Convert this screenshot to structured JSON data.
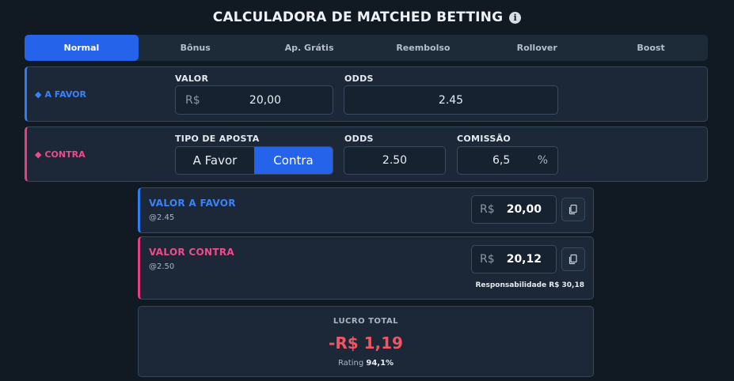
{
  "header": {
    "title": "CALCULADORA DE MATCHED BETTING",
    "info_icon": "info-icon"
  },
  "tabs": [
    {
      "label": "Normal",
      "active": true
    },
    {
      "label": "Bônus"
    },
    {
      "label": "Ap. Grátis"
    },
    {
      "label": "Reembolso"
    },
    {
      "label": "Rollover"
    },
    {
      "label": "Boost"
    }
  ],
  "favor": {
    "label": "A FAVOR",
    "valor_label": "VALOR",
    "currency": "R$",
    "valor": "20,00",
    "odds_label": "ODDS",
    "odds": "2.45",
    "accent": "#2f7cf6"
  },
  "contra": {
    "label": "CONTRA",
    "tipo_label": "TIPO DE APOSTA",
    "tipo_options": [
      "A Favor",
      "Contra"
    ],
    "tipo_selected": "Contra",
    "odds_label": "ODDS",
    "odds": "2.50",
    "comissao_label": "COMISSÃO",
    "comissao": "6,5",
    "comissao_unit": "%",
    "accent": "#e93d82"
  },
  "results": {
    "favor": {
      "title": "VALOR A FAVOR",
      "odds": "@2.45",
      "currency": "R$",
      "value": "20,00"
    },
    "contra": {
      "title": "VALOR CONTRA",
      "odds": "@2.50",
      "currency": "R$",
      "value": "20,12",
      "responsabilidade": "Responsabilidade R$ 30,18"
    }
  },
  "total": {
    "label": "LUCRO TOTAL",
    "value": "-R$ 1,19",
    "rating_label": "Rating",
    "rating_value": "94,1%",
    "value_color": "#f05563"
  }
}
